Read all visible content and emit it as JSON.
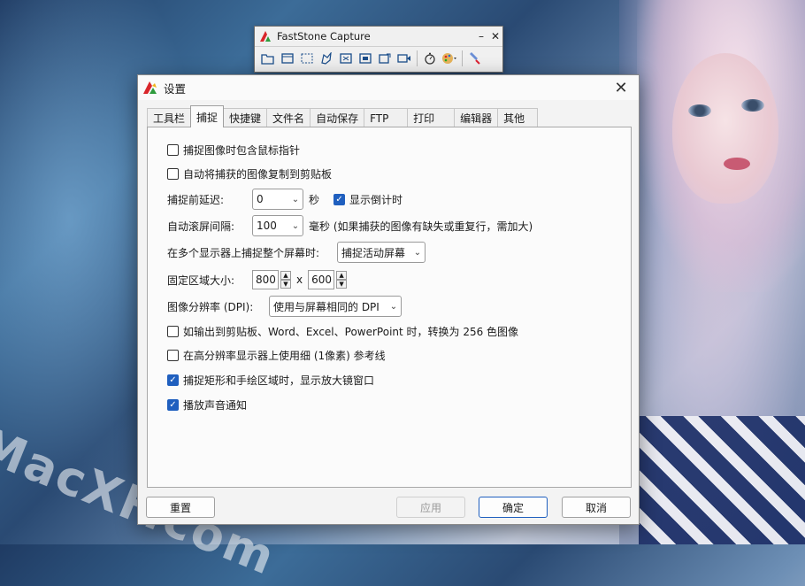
{
  "desktop": {
    "watermark": "MacXF.com"
  },
  "capture_toolbar": {
    "title": "FastStone Capture",
    "minimize": "–",
    "close": "✕",
    "tools": [
      "open-folder-icon",
      "capture-window-icon",
      "capture-rectangle-icon",
      "capture-freehand-icon",
      "capture-fullscreen-icon",
      "capture-scroll-icon",
      "capture-fixed-region-icon",
      "video-record-icon",
      "timer-icon",
      "palette-icon",
      "settings-icon"
    ]
  },
  "dialog": {
    "title": "设置",
    "close": "✕",
    "tabs": [
      "工具栏",
      "捕捉",
      "快捷键",
      "文件名",
      "自动保存",
      "FTP",
      "打印",
      "编辑器",
      "其他"
    ],
    "active_tab": "捕捉",
    "options": {
      "include_cursor": "捕捉图像时包含鼠标指针",
      "copy_clipboard": "自动将捕获的图像复制到剪贴板",
      "delay_label": "捕捉前延迟:",
      "delay_value": "0",
      "delay_unit": "秒",
      "show_countdown": "显示倒计时",
      "scroll_label": "自动滚屏间隔:",
      "scroll_value": "100",
      "scroll_note": "毫秒 (如果捕获的图像有缺失或重复行，需加大)",
      "multi_monitor_label": "在多个显示器上捕捉整个屏幕时:",
      "multi_monitor_value": "捕捉活动屏幕",
      "fixed_size_label": "固定区域大小:",
      "fixed_width": "800",
      "x_sep": "x",
      "fixed_height": "600",
      "dpi_label": "图像分辨率 (DPI):",
      "dpi_value": "使用与屏幕相同的 DPI",
      "convert_256": "如输出到剪贴板、Word、Excel、PowerPoint 时，转换为 256 色图像",
      "thin_lines": "在高分辨率显示器上使用细 (1像素) 参考线",
      "magnifier": "捕捉矩形和手绘区域时，显示放大镜窗口",
      "sound": "播放声音通知"
    },
    "checks": {
      "include_cursor": false,
      "copy_clipboard": false,
      "show_countdown": true,
      "convert_256": false,
      "thin_lines": false,
      "magnifier": true,
      "sound": true
    },
    "buttons": {
      "reset": "重置",
      "apply": "应用",
      "ok": "确定",
      "cancel": "取消"
    }
  }
}
